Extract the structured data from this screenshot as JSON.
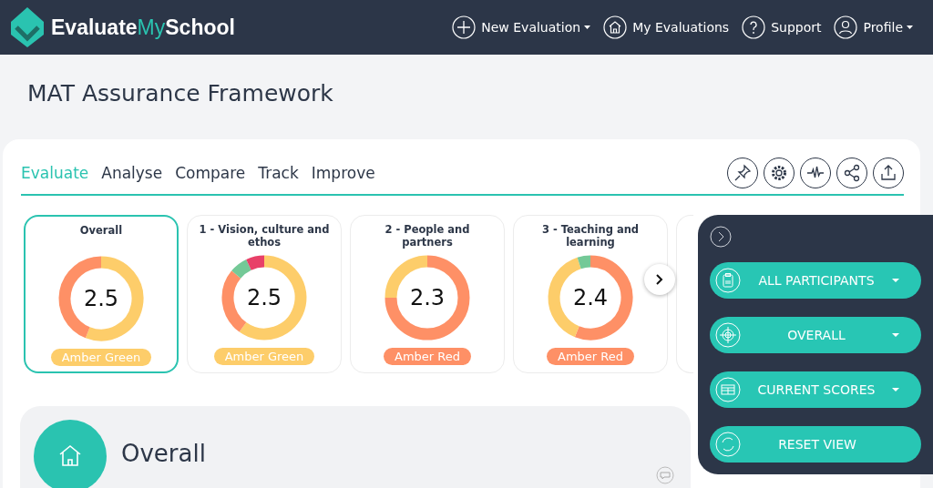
{
  "header": {
    "logo_parts": [
      "Evaluate",
      "My",
      "School"
    ],
    "nav": [
      {
        "label": "New Evaluation",
        "dropdown": true
      },
      {
        "label": "My Evaluations",
        "dropdown": false
      },
      {
        "label": "Support",
        "dropdown": false
      },
      {
        "label": "Profile",
        "dropdown": true
      }
    ]
  },
  "page_title": "MAT Assurance Framework",
  "tabs": [
    {
      "label": "Evaluate",
      "selected": true
    },
    {
      "label": "Analyse",
      "selected": false
    },
    {
      "label": "Compare",
      "selected": false
    },
    {
      "label": "Track",
      "selected": false
    },
    {
      "label": "Improve",
      "selected": false
    }
  ],
  "score_cards": [
    {
      "title": "Overall",
      "score": "2.5",
      "rating": "Amber Green",
      "color": "#fdcd6a",
      "selected": true
    },
    {
      "title": "1 - Vision, culture and ethos",
      "score": "2.5",
      "rating": "Amber Green",
      "color": "#fdcd6a",
      "selected": false
    },
    {
      "title": "2 - People and partners",
      "score": "2.3",
      "rating": "Amber Red",
      "color": "#fe9066",
      "selected": false
    },
    {
      "title": "3 - Teaching and learning",
      "score": "2.4",
      "rating": "Amber Red",
      "color": "#fe9066",
      "selected": false
    }
  ],
  "section": {
    "title": "Overall"
  },
  "side_panel": {
    "buttons": [
      {
        "label": "ALL PARTICIPANTS",
        "dropdown": true
      },
      {
        "label": "OVERALL",
        "dropdown": true
      },
      {
        "label": "CURRENT SCORES",
        "dropdown": true
      },
      {
        "label": "RESET VIEW",
        "dropdown": false
      }
    ]
  }
}
